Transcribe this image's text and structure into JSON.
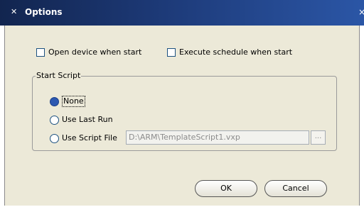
{
  "window": {
    "title": "Options",
    "app_icon": "minimize-icon",
    "close_glyph": "×"
  },
  "options": {
    "open_device_label": "Open device when start",
    "execute_schedule_label": "Execute schedule when start"
  },
  "start_script": {
    "legend": "Start Script",
    "none_label": "None",
    "last_run_label": "Use Last Run",
    "script_file_label": "Use Script File",
    "script_path": "D:\\ARM\\TemplateScript1.vxp",
    "browse_label": "..."
  },
  "buttons": {
    "ok_label": "OK",
    "cancel_label": "Cancel"
  },
  "colors": {
    "titlebar_start": "#12254f",
    "titlebar_end": "#2b56a6",
    "dialog_bg": "#ece9d8"
  }
}
